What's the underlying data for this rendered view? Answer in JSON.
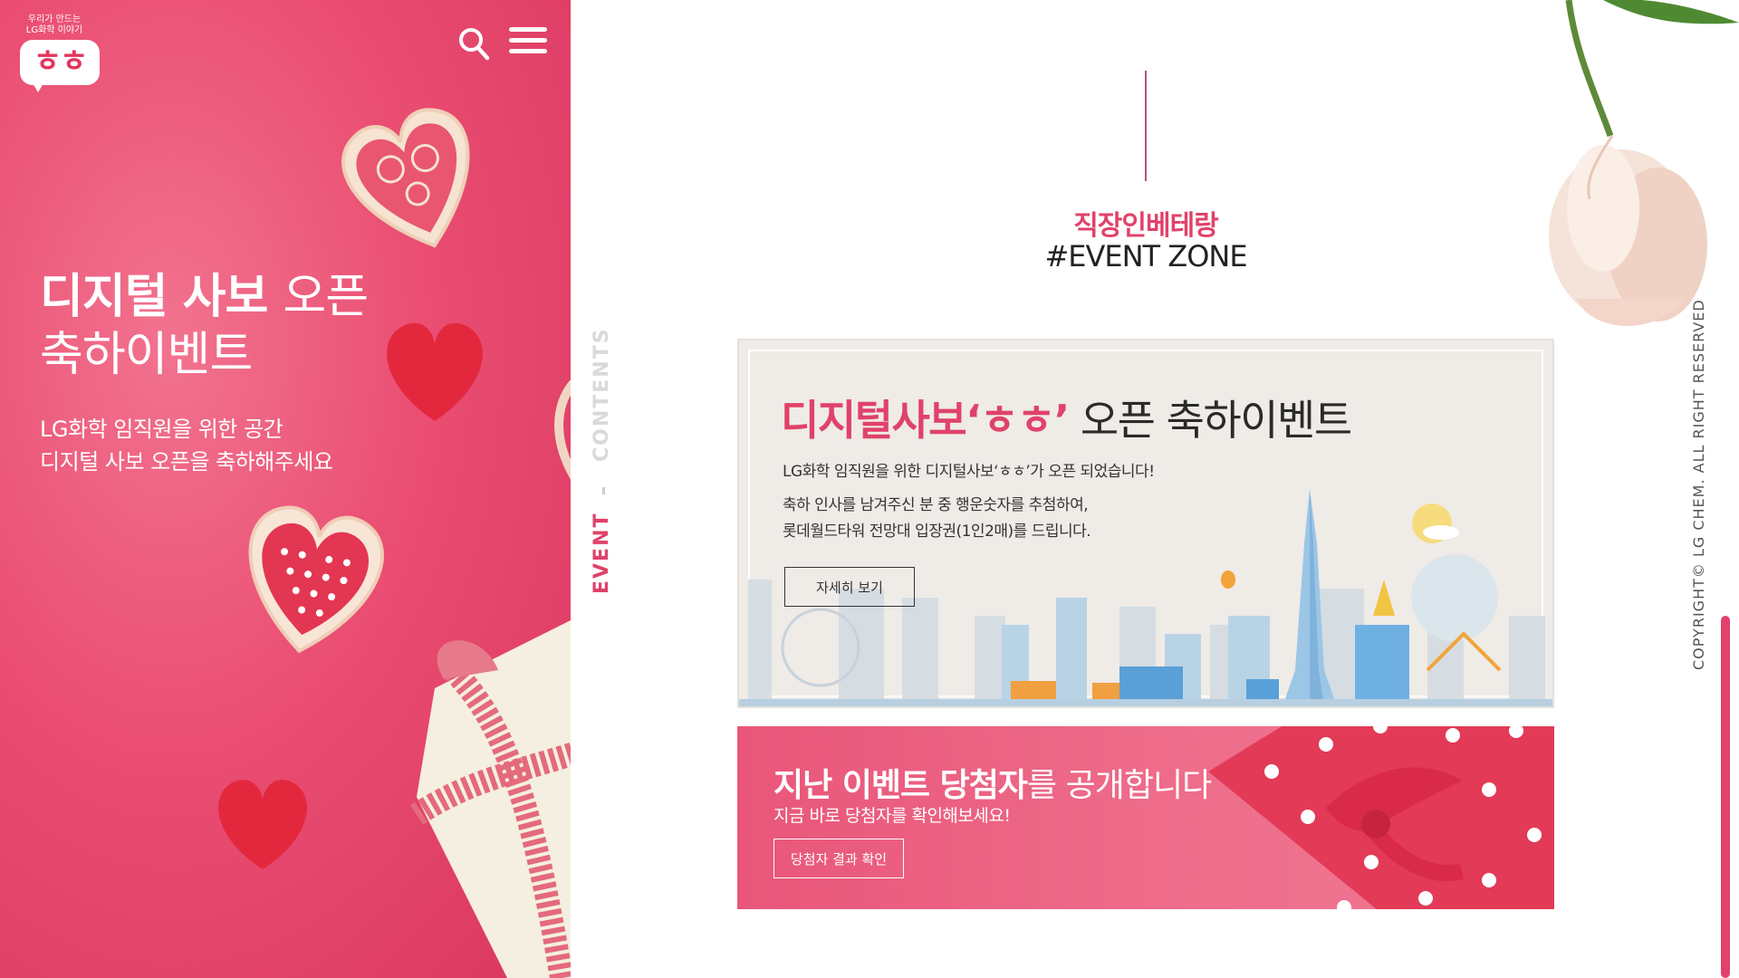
{
  "logo": {
    "tagline_line1": "우리가 만드는",
    "tagline_line2": "LG화학 이야기",
    "mark": "ㅎㅎ"
  },
  "header": {
    "search_icon": "search-icon",
    "menu_icon": "hamburger-menu-icon"
  },
  "hero": {
    "title_bold": "디지털 사보",
    "title_light": "오픈",
    "title_line2": "축하이벤트",
    "sub_line1": "LG화학 임직원을 위한 공간",
    "sub_line2": "디지털 사보 오픈을 축하해주세요"
  },
  "vertical_nav": {
    "contents": "CONTENTS",
    "event": "EVENT",
    "active": "EVENT"
  },
  "section": {
    "kicker": "직장인베테랑",
    "title": "#EVENT ZONE"
  },
  "event_card": {
    "title_pink": "디지털사보‘ㅎㅎ’",
    "title_dark": "오픈 축하이벤트",
    "line1": "LG화학 임직원을 위한 디지털사보‘ㅎㅎ’가 오픈 되었습니다!",
    "line2a": "축하 인사를 남겨주신 분 중 행운숫자를 추첨하여,",
    "line2b": "롯데월드타워 전망대 입장권(1인2매)를 드립니다.",
    "button": "자세히 보기"
  },
  "winners": {
    "title_bold": "지난 이벤트 당첨자",
    "title_rest": "를 공개합니다",
    "sub": "지금 바로 당첨자를 확인해보세요!",
    "button": "당첨자 결과 확인"
  },
  "copyright": "COPYRIGHT© LG CHEM. ALL RIGHT RESERVED",
  "colors": {
    "accent": "#e0426a",
    "hero_bg": "#ea4e72",
    "card_bg": "#efebe7",
    "line": "#b95087"
  }
}
